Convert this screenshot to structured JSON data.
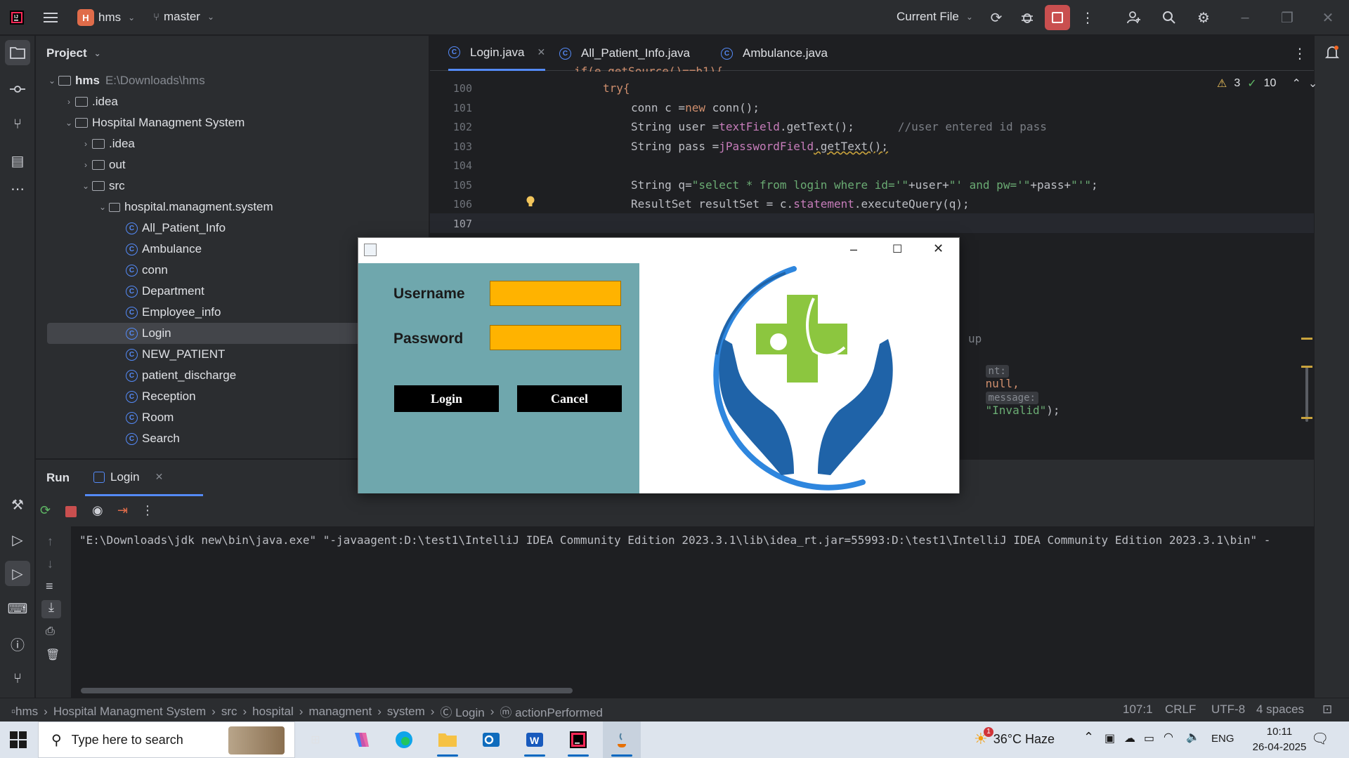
{
  "titlebar": {
    "project_badge": "H",
    "project_name": "hms",
    "branch": "master",
    "run_config": "Current File"
  },
  "project_panel": {
    "title": "Project",
    "tree": [
      {
        "label": "hms",
        "extra": "E:\\Downloads\\hms",
        "type": "folder",
        "depth": 0,
        "expanded": true,
        "bold": true
      },
      {
        "label": ".idea",
        "type": "folder",
        "depth": 1,
        "expanded": false
      },
      {
        "label": "Hospital Managment System",
        "type": "folder",
        "depth": 1,
        "expanded": true
      },
      {
        "label": ".idea",
        "type": "folder",
        "depth": 2,
        "expanded": false
      },
      {
        "label": "out",
        "type": "folder",
        "depth": 2,
        "expanded": false
      },
      {
        "label": "src",
        "type": "folder",
        "depth": 2,
        "expanded": true
      },
      {
        "label": "hospital.managment.system",
        "type": "package",
        "depth": 3,
        "expanded": true
      },
      {
        "label": "All_Patient_Info",
        "type": "class",
        "depth": 4
      },
      {
        "label": "Ambulance",
        "type": "class",
        "depth": 4
      },
      {
        "label": "conn",
        "type": "class",
        "depth": 4
      },
      {
        "label": "Department",
        "type": "class",
        "depth": 4
      },
      {
        "label": "Employee_info",
        "type": "class",
        "depth": 4
      },
      {
        "label": "Login",
        "type": "class",
        "depth": 4,
        "selected": true
      },
      {
        "label": "NEW_PATIENT",
        "type": "class",
        "depth": 4
      },
      {
        "label": "patient_discharge",
        "type": "class",
        "depth": 4
      },
      {
        "label": "Reception",
        "type": "class",
        "depth": 4
      },
      {
        "label": "Room",
        "type": "class",
        "depth": 4
      },
      {
        "label": "Search",
        "type": "class",
        "depth": 4
      }
    ]
  },
  "editor": {
    "tabs": [
      {
        "label": "Login.java",
        "active": true,
        "closable": true
      },
      {
        "label": "All_Patient_Info.java",
        "active": false
      },
      {
        "label": "Ambulance.java",
        "active": false
      }
    ],
    "warnings": "3",
    "checks": "10",
    "partial_top": "if(e.getSource()==b1){",
    "line_numbers": [
      "100",
      "101",
      "102",
      "103",
      "104",
      "105",
      "106",
      "107"
    ],
    "code": {
      "l100": "try{",
      "l101a": "conn c =",
      "l101b": "new",
      "l101c": " conn();",
      "l102a": "String user =",
      "l102b": "textField",
      "l102c": ".getText();",
      "l102d": "//user entered id pass",
      "l103a": "String pass =",
      "l103b": "jPasswordField",
      "l103c": ".getText();",
      "l105a": "String q=",
      "l105b": "\"select * from login where id='\"",
      "l105c": "+user+",
      "l105d": "\"' and pw='\"",
      "l105e": "+pass+",
      "l105f": "\"'\"",
      "l105g": ";",
      "l106a": "ResultSet resultSet = c.",
      "l106b": "statement",
      "l106c": ".executeQuery(q);",
      "frag_up": "up",
      "frag_hint1": "nt:",
      "frag_null": "null,",
      "frag_hint2": "message:",
      "frag_str": "\"Invalid\"",
      "frag_end": ");"
    }
  },
  "run_panel": {
    "tab_run": "Run",
    "tab_login": "Login",
    "console_line": "\"E:\\Downloads\\jdk new\\bin\\java.exe\" \"-javaagent:D:\\test1\\IntelliJ IDEA Community Edition 2023.3.1\\lib\\idea_rt.jar=55993:D:\\test1\\IntelliJ IDEA Community Edition 2023.3.1\\bin\" -"
  },
  "statusbar": {
    "breadcrumbs": [
      "hms",
      "Hospital Managment System",
      "src",
      "hospital",
      "managment",
      "system",
      "Login",
      "actionPerformed"
    ],
    "position": "107:1",
    "line_ending": "CRLF",
    "encoding": "UTF-8",
    "indent": "4 spaces"
  },
  "dialog": {
    "username_label": "Username",
    "password_label": "Password",
    "username_value": "",
    "password_value": "",
    "login_button": "Login",
    "cancel_button": "Cancel"
  },
  "taskbar": {
    "search_placeholder": "Type here to search",
    "weather_badge": "1",
    "weather": "36°C  Haze",
    "language": "ENG",
    "time": "10:11",
    "date": "26-04-2025"
  },
  "colors": {
    "accent": "#548af7",
    "dialog_panel": "#6fa7ad",
    "input_fill": "#ffb300",
    "logo_blue": "#1f63a8",
    "logo_green": "#8cc63f"
  }
}
